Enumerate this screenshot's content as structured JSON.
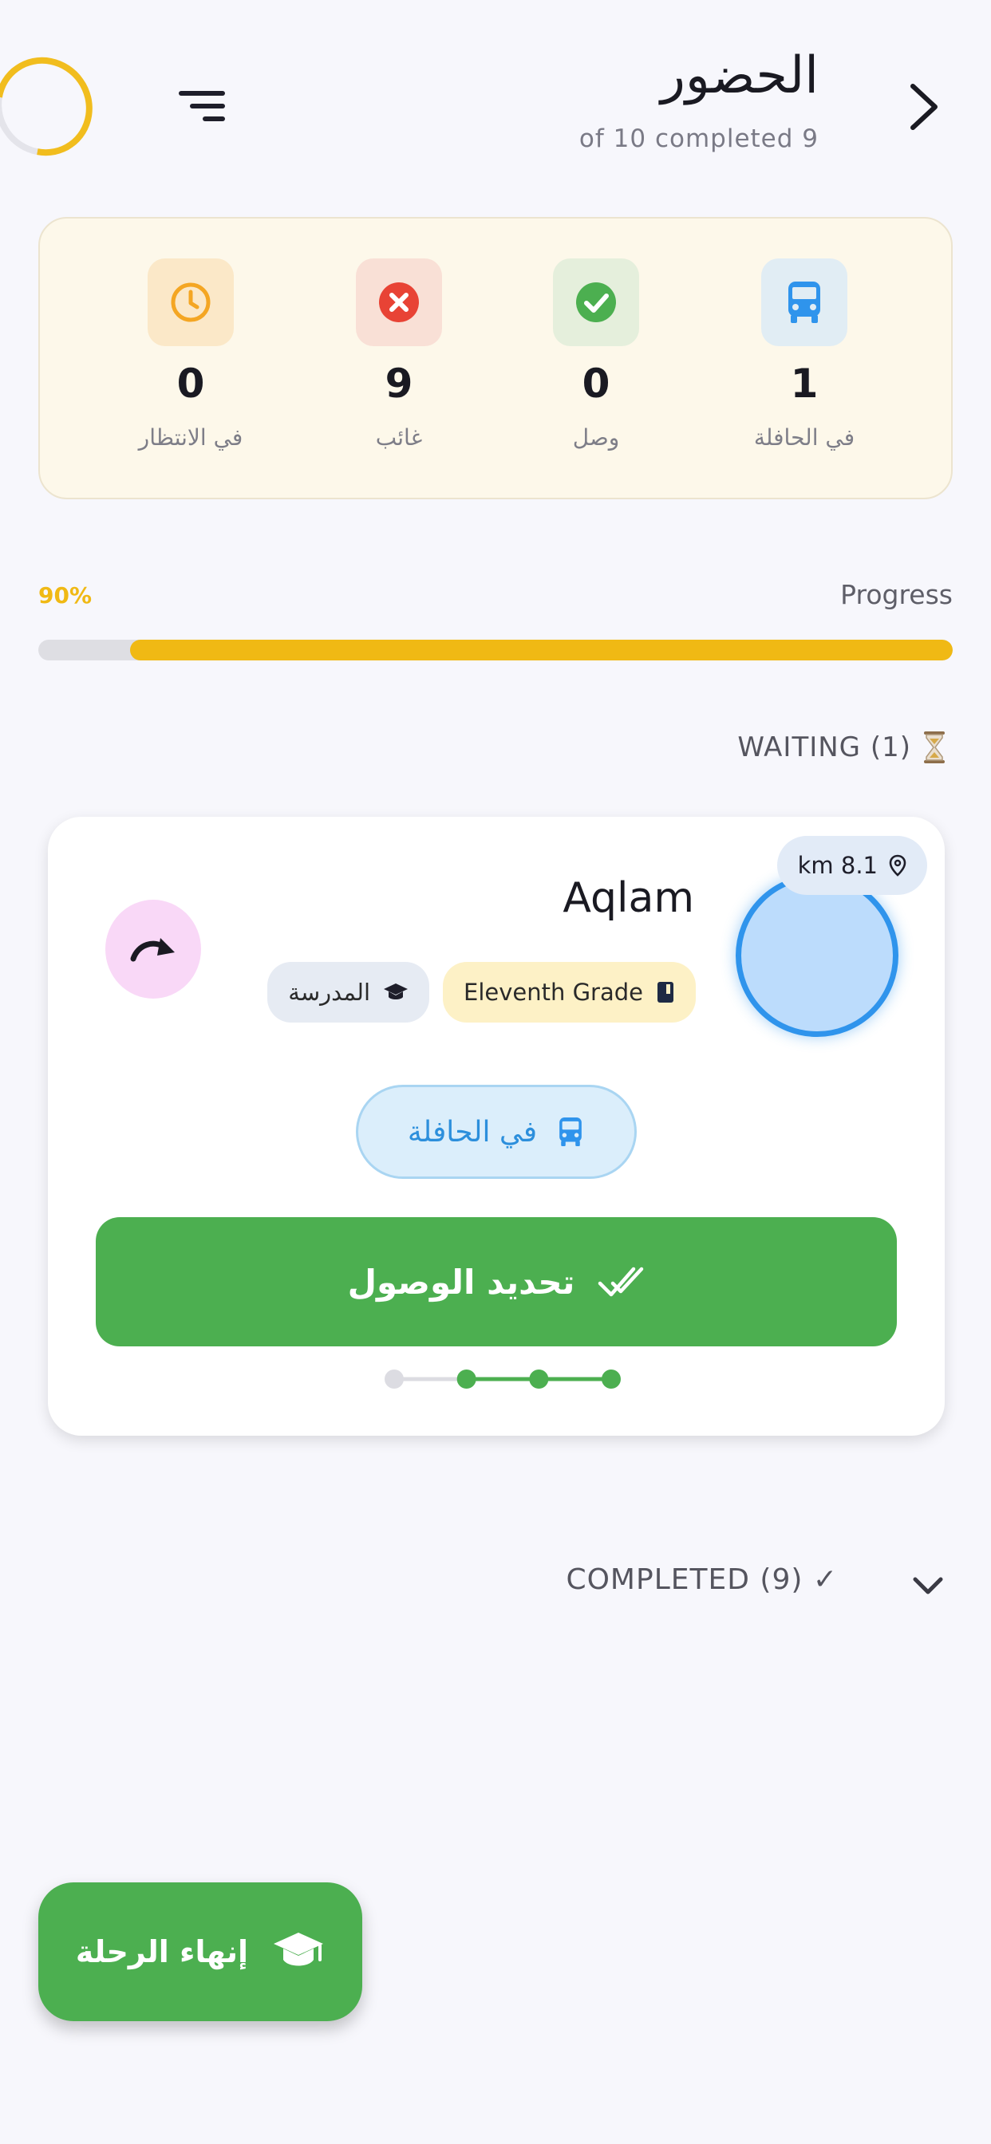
{
  "header": {
    "title": "الحضور",
    "subtitle": "of 10 completed 9"
  },
  "stats": [
    {
      "value": "1",
      "label": "في الحافلة",
      "icon": "bus-icon",
      "color": "#2f94ec"
    },
    {
      "value": "0",
      "label": "وصل",
      "icon": "check-circle-icon",
      "color": "#4caf50"
    },
    {
      "value": "9",
      "label": "غائب",
      "icon": "x-circle-icon",
      "color": "#e84335"
    },
    {
      "value": "0",
      "label": "في الانتظار",
      "icon": "clock-icon",
      "color": "#f4a623"
    }
  ],
  "progress": {
    "label": "Progress",
    "percent_text": "90%",
    "fraction": 0.9
  },
  "waiting": {
    "header": "WAITING (1)",
    "icon": "hourglass-icon"
  },
  "student": {
    "name": "Aqlam",
    "distance": "km 8.1",
    "grade": "Eleventh Grade",
    "school": "المدرسة",
    "status": "في الحافلة",
    "action_label": "تحديد الوصول",
    "steps_total": 4,
    "steps_done": 3
  },
  "completed": {
    "header": "COMPLETED (9) ✓"
  },
  "fab": {
    "label": "إنهاء الرحلة"
  },
  "colors": {
    "accent_yellow": "#f0b914",
    "green": "#4caf50",
    "blue": "#2f94ec"
  }
}
